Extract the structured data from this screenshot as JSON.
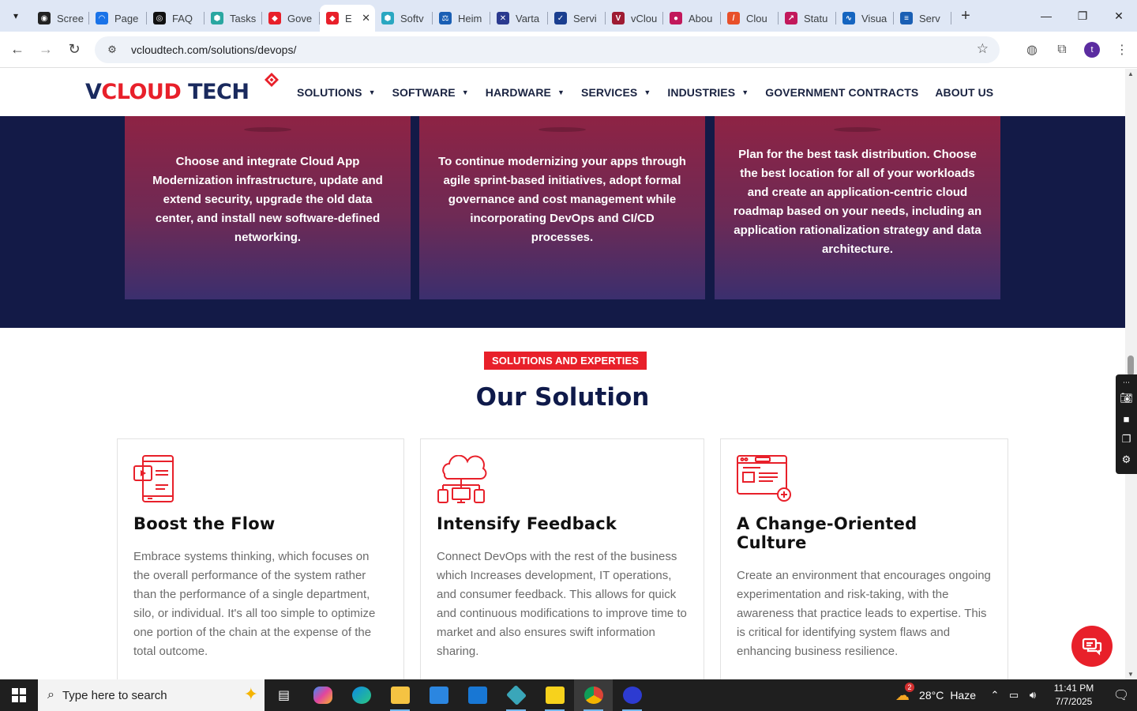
{
  "browser": {
    "tabs": [
      {
        "label": "Scree",
        "fav_color": "#222222",
        "fav_glyph": "◉"
      },
      {
        "label": "Page",
        "fav_color": "#1a73e8",
        "fav_glyph": "◠"
      },
      {
        "label": "FAQ",
        "fav_color": "#111111",
        "fav_glyph": "◎"
      },
      {
        "label": "Tasks",
        "fav_color": "#2aa7a1",
        "fav_glyph": "⬢"
      },
      {
        "label": "Gove",
        "fav_color": "#e8202a",
        "fav_glyph": "◆"
      },
      {
        "label": "E",
        "fav_color": "#e8202a",
        "fav_glyph": "◆",
        "active": true
      },
      {
        "label": "Softv",
        "fav_color": "#2aa7c1",
        "fav_glyph": "⬢"
      },
      {
        "label": "Heim",
        "fav_color": "#1a5fb4",
        "fav_glyph": "⚖"
      },
      {
        "label": "Varta",
        "fav_color": "#2b3a8f",
        "fav_glyph": "✕"
      },
      {
        "label": "Servi",
        "fav_color": "#1a3e8f",
        "fav_glyph": "✓"
      },
      {
        "label": "vClou",
        "fav_color": "#9e1b32",
        "fav_glyph": "V"
      },
      {
        "label": "Abou",
        "fav_color": "#c2185b",
        "fav_glyph": "●"
      },
      {
        "label": "Clou",
        "fav_color": "#e8502a",
        "fav_glyph": "/"
      },
      {
        "label": "Statu",
        "fav_color": "#c2185b",
        "fav_glyph": "↗"
      },
      {
        "label": "Visua",
        "fav_color": "#1565c0",
        "fav_glyph": "∿"
      },
      {
        "label": "Serv",
        "fav_color": "#1a5fb4",
        "fav_glyph": "≡"
      }
    ],
    "url": "vcloudtech.com/solutions/devops/",
    "profile_initial": "t"
  },
  "site": {
    "logo": {
      "part1": "V",
      "part2": "CLOUD",
      "part3": " TECH"
    },
    "nav": [
      {
        "label": "SOLUTIONS",
        "dropdown": true
      },
      {
        "label": "SOFTWARE",
        "dropdown": true
      },
      {
        "label": "HARDWARE",
        "dropdown": true
      },
      {
        "label": "SERVICES",
        "dropdown": true
      },
      {
        "label": "INDUSTRIES",
        "dropdown": true
      },
      {
        "label": "GOVERNMENT CONTRACTS",
        "dropdown": false
      },
      {
        "label": "ABOUT US",
        "dropdown": false
      }
    ],
    "hero_cards": [
      "Choose and integrate Cloud App Modernization infrastructure, update and extend security, upgrade the old data center, and install new software-defined networking.",
      "To continue modernizing your apps through agile sprint-based initiatives, adopt formal governance and cost management while incorporating DevOps and CI/CD processes.",
      "Plan for the best task distribution. Choose the best location for all of your workloads and create an application-centric cloud roadmap based on your needs, including an application rationalization strategy and data architecture."
    ],
    "section_badge": "SOLUTIONS AND EXPERTIES",
    "section_title": "Our Solution",
    "solutions": [
      {
        "icon": "mobile-media-icon",
        "title": "Boost the Flow",
        "text": "Embrace systems thinking, which focuses on the overall performance of the system rather than the performance of a single department, silo, or individual. It's all too simple to optimize one portion of the chain at the expense of the total outcome."
      },
      {
        "icon": "cloud-network-icon",
        "title": "Intensify Feedback",
        "text": "Connect DevOps with the rest of the business which Increases development, IT operations, and consumer feedback. This allows for quick and continuous modifications to improve time to market and also ensures swift information sharing."
      },
      {
        "icon": "browser-window-icon",
        "title": "A Change-Oriented Culture",
        "text": "Create an environment that encourages ongoing experimentation and risk-taking, with the awareness that practice leads to expertise. This is critical for identifying system flaws and enhancing business resilience."
      }
    ]
  },
  "taskbar": {
    "search_placeholder": "Type here to search",
    "weather_temp": "28°C",
    "weather_desc": "Haze",
    "weather_badge": "2",
    "time": "11:41 PM",
    "date": "7/7/2025"
  },
  "colors": {
    "brand_red": "#e8202a",
    "brand_navy": "#131a47"
  }
}
